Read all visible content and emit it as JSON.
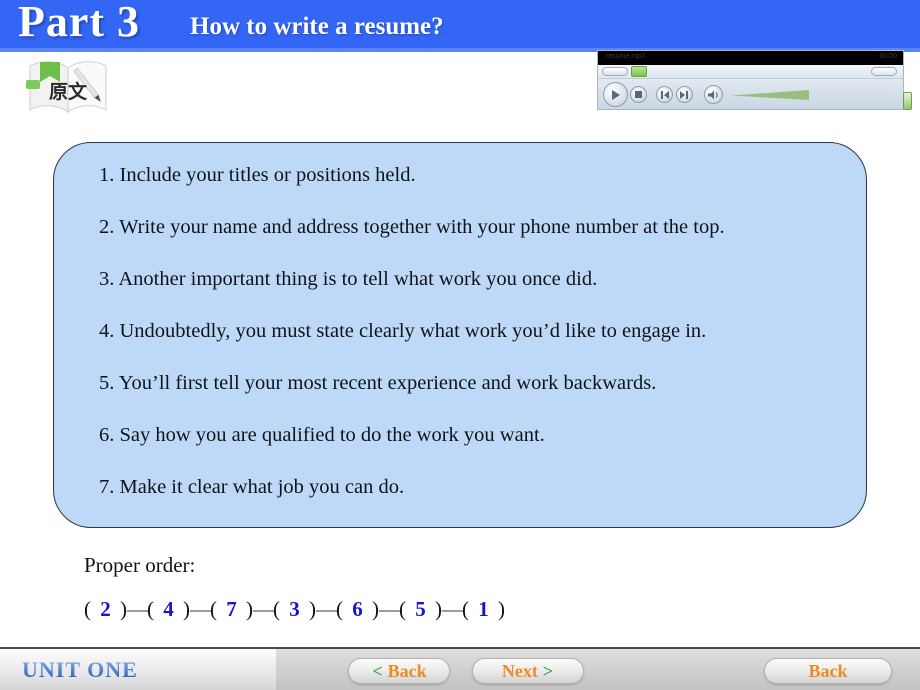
{
  "header": {
    "part_title": "Part 3",
    "subtitle": "How to write a resume?",
    "bg_color": "#3366f5"
  },
  "book_icon": {
    "name": "original-text-book-icon",
    "caption": "原文"
  },
  "media_player": {
    "video_label": "resume.mp3",
    "video_time": "00:00",
    "controls": [
      {
        "name": "play-button",
        "glyph": "▶"
      },
      {
        "name": "stop-button",
        "glyph": "■"
      },
      {
        "name": "rewind-button",
        "glyph": "◀"
      },
      {
        "name": "forward-button",
        "glyph": "▶"
      },
      {
        "name": "volume-button",
        "glyph": "🔈"
      }
    ]
  },
  "content": {
    "items": [
      "1. Include your titles or positions held.",
      "2. Write your name and address together with your phone number at the top.",
      "3. Another important thing is to tell what work you once did.",
      "4. Undoubtedly, you must state clearly what work you’d like to engage in.",
      "5. You’ll first tell your most recent experience and work backwards.",
      "6. Say how you are qualified to do the work you want.",
      "7. Make it clear what job you can do."
    ],
    "box_fill": "#bdd9f7"
  },
  "proper_order": {
    "label": "Proper order:",
    "sequence": [
      2,
      4,
      7,
      3,
      6,
      5,
      1
    ],
    "open_paren": "(",
    "close_paren": ")",
    "separator": "—",
    "number_color": "#1616c8"
  },
  "footer": {
    "unit_label": "UNIT ONE",
    "buttons": [
      {
        "name": "back-nav-button",
        "prefix": "<",
        "word": "Back",
        "suffix": ""
      },
      {
        "name": "next-nav-button",
        "prefix": "",
        "word": "Next",
        "suffix": ">"
      },
      {
        "name": "back-right-button",
        "prefix": "",
        "word": "Back",
        "suffix": ""
      }
    ],
    "arrow_color": "#3aa83a",
    "word_color": "#ef8a22"
  }
}
